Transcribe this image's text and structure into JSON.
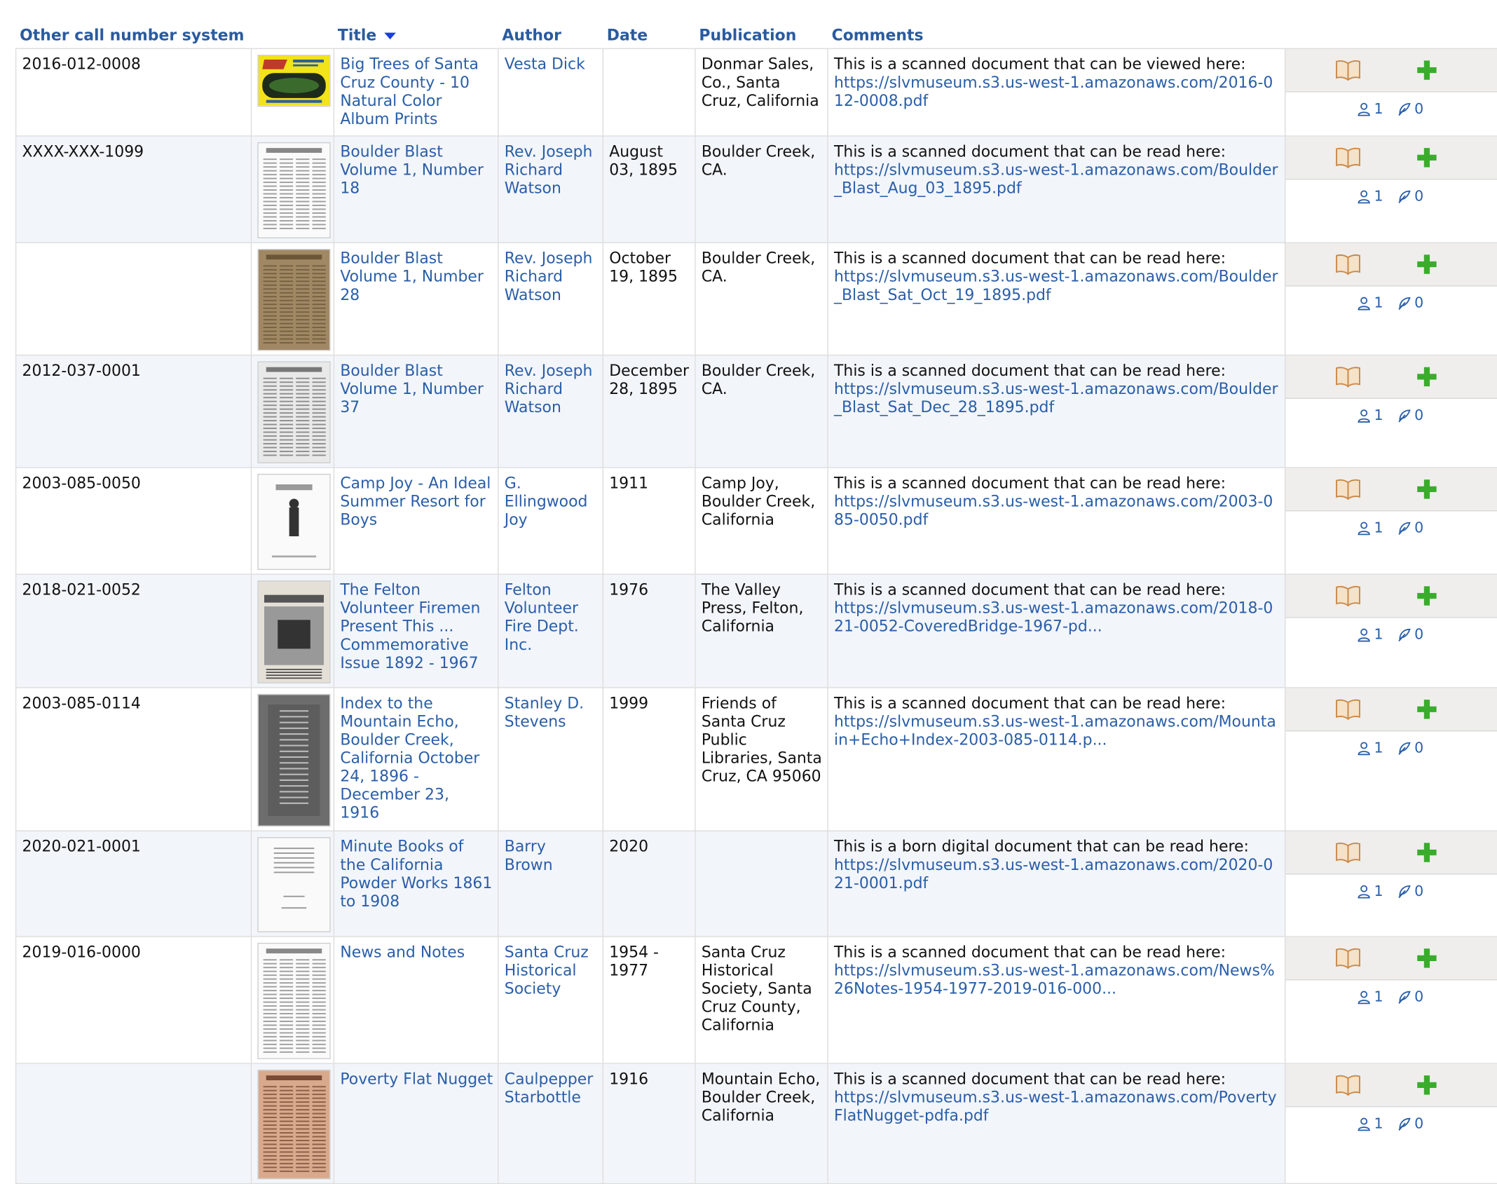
{
  "headers": {
    "call_number": "Other call number system",
    "title": "Title",
    "author": "Author",
    "date": "Date",
    "publication": "Publication",
    "comments": "Comments"
  },
  "icons": {
    "view": "open-book-icon",
    "add": "plus-icon",
    "users": "user-icon",
    "comments": "feather-icon",
    "sort": "sort-desc-icon"
  },
  "colors": {
    "link": "#2a5ea8",
    "header": "#2a5b9f",
    "add": "#3aac2c",
    "book": "#c98a4a",
    "row_alt": "#f2f5fa"
  },
  "rows": [
    {
      "call": "2016-012-0008",
      "title": "Big Trees of Santa Cruz County - 10 Natural Color Album Prints",
      "author": "Vesta Dick",
      "date": "",
      "publication": "Donmar Sales, Co., Santa Cruz, California",
      "comment_text": "This is a scanned document that can be viewed here:",
      "comment_url": "https://slvmuseum.s3.us-west-1.amazonaws.com/2016-012-0008.pdf",
      "users": "1",
      "notes": "0",
      "thumb": "yellow-cover"
    },
    {
      "call": "XXXX-XXX-1099",
      "title": "Boulder Blast Volume 1, Number 18",
      "author": "Rev. Joseph Richard Watson",
      "date": "August 03, 1895",
      "publication": "Boulder Creek, CA.",
      "comment_text": "This is a scanned document that can be read here:",
      "comment_url": "https://slvmuseum.s3.us-west-1.amazonaws.com/Boulder_Blast_Aug_03_1895.pdf",
      "users": "1",
      "notes": "0",
      "thumb": "newspaper-white"
    },
    {
      "call": "",
      "title": "Boulder Blast Volume 1, Number 28",
      "author": "Rev. Joseph Richard Watson",
      "date": "October 19, 1895",
      "publication": "Boulder Creek, CA.",
      "comment_text": "This is a scanned document that can be read here:",
      "comment_url": "https://slvmuseum.s3.us-west-1.amazonaws.com/Boulder_Blast_Sat_Oct_19_1895.pdf",
      "users": "1",
      "notes": "0",
      "thumb": "newspaper-tan"
    },
    {
      "call": "2012-037-0001",
      "title": "Boulder Blast Volume 1, Number 37",
      "author": "Rev. Joseph Richard Watson",
      "date": "December 28, 1895",
      "publication": "Boulder Creek, CA.",
      "comment_text": "This is a scanned document that can be read here:",
      "comment_url": "https://slvmuseum.s3.us-west-1.amazonaws.com/Boulder_Blast_Sat_Dec_28_1895.pdf",
      "users": "1",
      "notes": "0",
      "thumb": "newspaper-gray"
    },
    {
      "call": "2003-085-0050",
      "title": "Camp Joy - An Ideal Summer Resort for Boys",
      "author": "G. Ellingwood Joy",
      "date": "1911",
      "publication": "Camp Joy, Boulder Creek, California",
      "comment_text": "This is a scanned document that can be read here:",
      "comment_url": "https://slvmuseum.s3.us-west-1.amazonaws.com/2003-085-0050.pdf",
      "users": "1",
      "notes": "0",
      "thumb": "booklet-white"
    },
    {
      "call": "2018-021-0052",
      "title": "The Felton Volunteer Firemen Present This ... Commemorative Issue 1892 - 1967",
      "author": "Felton Volunteer Fire Dept. Inc.",
      "date": "1976",
      "publication": "The Valley Press, Felton, California",
      "comment_text": "This is a scanned document that can be read here:",
      "comment_url": "https://slvmuseum.s3.us-west-1.amazonaws.com/2018-021-0052-CoveredBridge-1967-pd...",
      "users": "1",
      "notes": "0",
      "thumb": "commemorative"
    },
    {
      "call": "2003-085-0114",
      "title": "Index to the Mountain Echo, Boulder Creek, California October 24, 1896 - December 23, 1916",
      "author": "Stanley D. Stevens",
      "date": "1999",
      "publication": "Friends of Santa Cruz Public Libraries, Santa Cruz, CA 95060",
      "comment_text": "This is a scanned document that can be read here:",
      "comment_url": "https://slvmuseum.s3.us-west-1.amazonaws.com/Mountain+Echo+Index-2003-085-0114.p...",
      "users": "1",
      "notes": "0",
      "thumb": "dark-gray"
    },
    {
      "call": "2020-021-0001",
      "title": "Minute Books of the California Powder Works 1861 to 1908",
      "author": "Barry Brown",
      "date": "2020",
      "publication": "",
      "comment_text": "This is a born digital document that can be read here:",
      "comment_url": "https://slvmuseum.s3.us-west-1.amazonaws.com/2020-021-0001.pdf",
      "users": "1",
      "notes": "0",
      "thumb": "title-page"
    },
    {
      "call": "2019-016-0000",
      "title": "News and Notes",
      "author": "Santa Cruz Historical Society",
      "date": "1954 - 1977",
      "publication": "Santa Cruz Historical Society, Santa Cruz County, California",
      "comment_text": "This is a scanned document that can be read here:",
      "comment_url": "https://slvmuseum.s3.us-west-1.amazonaws.com/News%26Notes-1954-1977-2019-016-000...",
      "users": "1",
      "notes": "0",
      "thumb": "text-page"
    },
    {
      "call": "",
      "title": "Poverty Flat Nugget",
      "author": "Caulpepper Starbottle",
      "date": "1916",
      "publication": "Mountain Echo, Boulder Creek, California",
      "comment_text": "This is a scanned document that can be read here:",
      "comment_url": "https://slvmuseum.s3.us-west-1.amazonaws.com/PovertyFlatNugget-pdfa.pdf",
      "users": "1",
      "notes": "0",
      "thumb": "newspaper-pink"
    }
  ]
}
